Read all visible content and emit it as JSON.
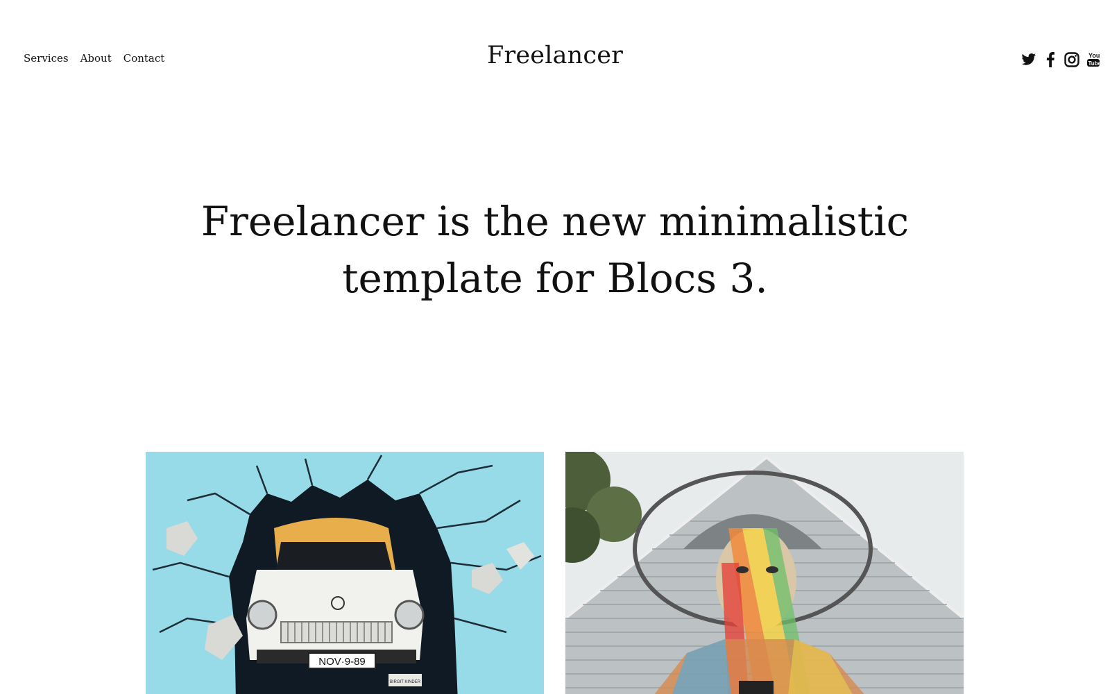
{
  "nav": {
    "items": [
      {
        "label": "Services"
      },
      {
        "label": "About"
      },
      {
        "label": "Contact"
      }
    ]
  },
  "brand": {
    "title": "Freelancer"
  },
  "social": {
    "icons": [
      "twitter-icon",
      "facebook-icon",
      "instagram-icon",
      "youtube-icon"
    ]
  },
  "hero": {
    "line1": "Freelancer is the new minimalistic",
    "line2": "template for Blocs 3."
  },
  "gallery": {
    "images": [
      {
        "description_icon": "car-mural-image",
        "plate_text": "NOV·9-89",
        "small_sign": "BIRGIT KINDER"
      },
      {
        "description_icon": "portrait-mural-image"
      }
    ]
  },
  "colors": {
    "text": "#111111",
    "background": "#ffffff",
    "mural_sky": "#8fd8e6",
    "mural_gray": "#c9cdd0"
  }
}
